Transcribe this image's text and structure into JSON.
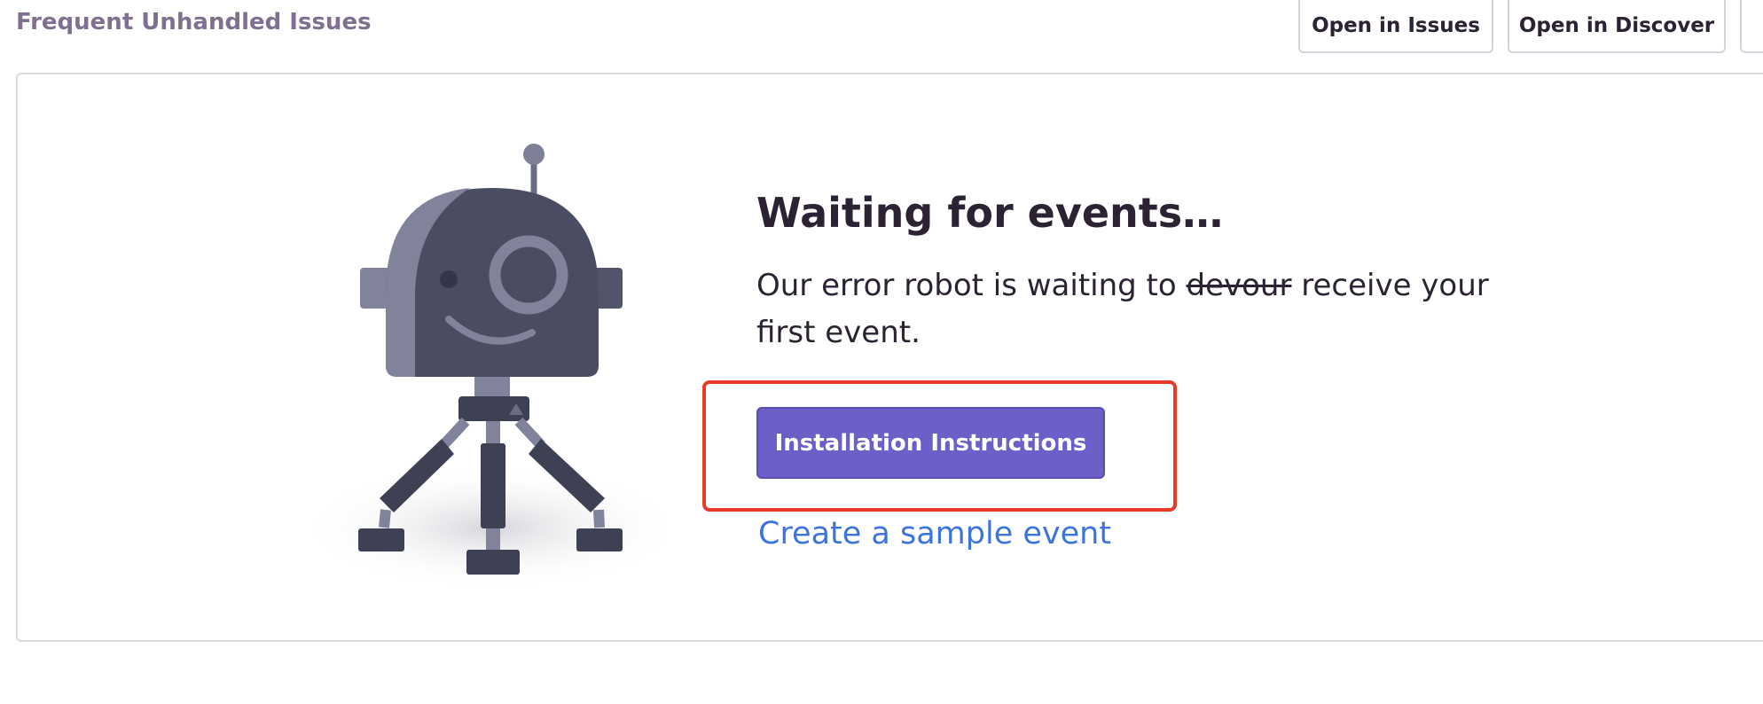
{
  "header": {
    "title": "Frequent Unhandled Issues",
    "open_issues_label": "Open in Issues",
    "open_discover_label": "Open in Discover"
  },
  "empty_state": {
    "heading": "Waiting for events…",
    "desc_prefix": "Our error robot is waiting to ",
    "desc_strike": "devour",
    "desc_suffix": " receive your first event.",
    "install_label": "Installation Instructions",
    "sample_link_label": "Create a sample event",
    "illustration": "robot-illustration"
  },
  "colors": {
    "accent": "#6c5fc7",
    "link": "#3d74db",
    "highlight": "#e83a26",
    "muted_title": "#80708f"
  }
}
